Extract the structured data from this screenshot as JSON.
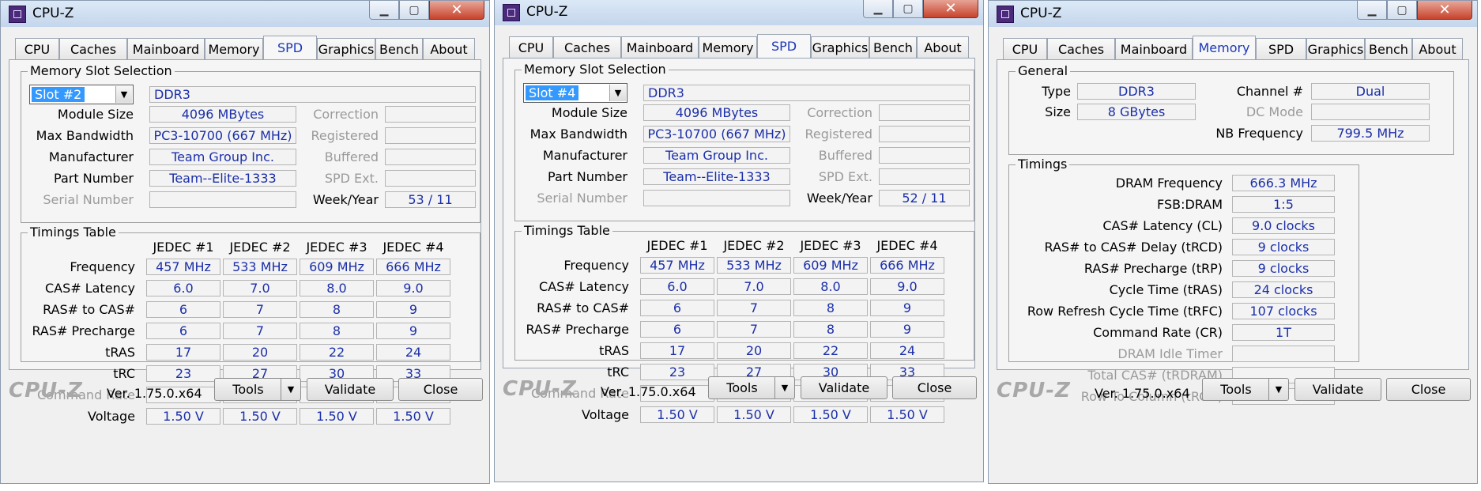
{
  "common": {
    "app_title": "CPU-Z",
    "tabs": [
      "CPU",
      "Caches",
      "Mainboard",
      "Memory",
      "SPD",
      "Graphics",
      "Bench",
      "About"
    ],
    "brand": "CPU-Z",
    "version": "Ver. 1.75.0.x64",
    "tools_label": "Tools",
    "validate_label": "Validate",
    "close_label": "Close",
    "win_min": "▁",
    "win_max": "▢",
    "win_close": "✕",
    "dropdown_arrow": "▼"
  },
  "spd_labels": {
    "slot_group": "Memory Slot Selection",
    "module_size": "Module Size",
    "max_bandwidth": "Max Bandwidth",
    "manufacturer": "Manufacturer",
    "part_number": "Part Number",
    "serial_number": "Serial Number",
    "correction": "Correction",
    "registered": "Registered",
    "buffered": "Buffered",
    "spd_ext": "SPD Ext.",
    "week_year": "Week/Year",
    "timings_group": "Timings Table",
    "rows": [
      "Frequency",
      "CAS# Latency",
      "RAS# to CAS#",
      "RAS# Precharge",
      "tRAS",
      "tRC",
      "Command Rate",
      "Voltage"
    ],
    "jedec_headers": [
      "JEDEC #1",
      "JEDEC #2",
      "JEDEC #3",
      "JEDEC #4"
    ]
  },
  "spd_windows": [
    {
      "slot": "Slot #2",
      "type": "DDR3",
      "module_size": "4096 MBytes",
      "max_bandwidth": "PC3-10700 (667 MHz)",
      "manufacturer": "Team Group Inc.",
      "part_number": "Team--Elite-1333",
      "serial_number": "",
      "week_year": "53 / 11"
    },
    {
      "slot": "Slot #4",
      "type": "DDR3",
      "module_size": "4096 MBytes",
      "max_bandwidth": "PC3-10700 (667 MHz)",
      "manufacturer": "Team Group Inc.",
      "part_number": "Team--Elite-1333",
      "serial_number": "",
      "week_year": "52 / 11"
    }
  ],
  "timings_table": [
    [
      "457 MHz",
      "533 MHz",
      "609 MHz",
      "666 MHz"
    ],
    [
      "6.0",
      "7.0",
      "8.0",
      "9.0"
    ],
    [
      "6",
      "7",
      "8",
      "9"
    ],
    [
      "6",
      "7",
      "8",
      "9"
    ],
    [
      "17",
      "20",
      "22",
      "24"
    ],
    [
      "23",
      "27",
      "30",
      "33"
    ],
    [
      "",
      "",
      "",
      ""
    ],
    [
      "1.50 V",
      "1.50 V",
      "1.50 V",
      "1.50 V"
    ]
  ],
  "memory": {
    "general_group": "General",
    "type_label": "Type",
    "type": "DDR3",
    "size_label": "Size",
    "size": "8 GBytes",
    "channel_label": "Channel #",
    "channel": "Dual",
    "dc_mode_label": "DC Mode",
    "dc_mode": "",
    "nb_freq_label": "NB Frequency",
    "nb_freq": "799.5 MHz",
    "timings_group": "Timings",
    "timings": [
      {
        "label": "DRAM Frequency",
        "value": "666.3 MHz"
      },
      {
        "label": "FSB:DRAM",
        "value": "1:5"
      },
      {
        "label": "CAS# Latency (CL)",
        "value": "9.0 clocks"
      },
      {
        "label": "RAS# to CAS# Delay (tRCD)",
        "value": "9 clocks"
      },
      {
        "label": "RAS# Precharge (tRP)",
        "value": "9 clocks"
      },
      {
        "label": "Cycle Time (tRAS)",
        "value": "24 clocks"
      },
      {
        "label": "Row Refresh Cycle Time (tRFC)",
        "value": "107 clocks"
      },
      {
        "label": "Command Rate (CR)",
        "value": "1T"
      },
      {
        "label": "DRAM Idle Timer",
        "value": ""
      },
      {
        "label": "Total CAS# (tRDRAM)",
        "value": ""
      },
      {
        "label": "Row To Column (tRCD)",
        "value": ""
      }
    ]
  }
}
